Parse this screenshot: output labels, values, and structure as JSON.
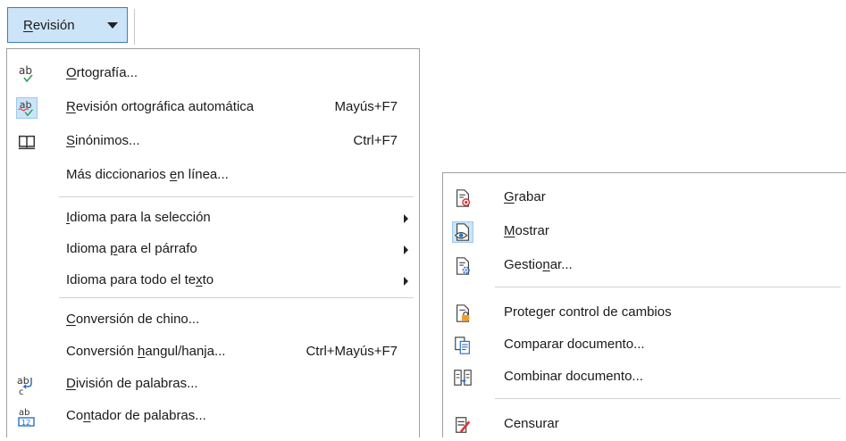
{
  "toolbar": {
    "button": {
      "label_u": "R",
      "label_rest": "evisión"
    }
  },
  "menu_review": {
    "items": [
      {
        "pre": "",
        "u": "O",
        "post": "rtografía...",
        "shortcut": "",
        "icon": "spellcheck-icon"
      },
      {
        "pre": "",
        "u": "R",
        "post": "evisión ortográfica automática",
        "shortcut": "Mayús+F7",
        "icon": "auto-spellcheck-icon"
      },
      {
        "pre": "",
        "u": "S",
        "post": "inónimos...",
        "shortcut": "Ctrl+F7",
        "icon": "thesaurus-book-icon"
      },
      {
        "pre": "Más diccionarios ",
        "u": "e",
        "post": "n línea...",
        "shortcut": ""
      },
      {
        "pre": "",
        "u": "I",
        "post": "dioma para la selección",
        "shortcut": ""
      },
      {
        "pre": "Idioma ",
        "u": "p",
        "post": "ara el párrafo",
        "shortcut": ""
      },
      {
        "pre": "Idioma para todo el te",
        "u": "x",
        "post": "to",
        "shortcut": ""
      },
      {
        "pre": "",
        "u": "C",
        "post": "onversión de chino...",
        "shortcut": ""
      },
      {
        "pre": "Conversión ",
        "u": "h",
        "post": "angul/hanja...",
        "shortcut": "Ctrl+Mayús+F7"
      },
      {
        "pre": "",
        "u": "D",
        "post": "ivisión de palabras...",
        "shortcut": "",
        "icon": "hyphenation-icon"
      },
      {
        "pre": "Co",
        "u": "n",
        "post": "tador de palabras...",
        "shortcut": "",
        "icon": "word-count-icon"
      }
    ]
  },
  "menu_track_changes": {
    "items": [
      {
        "pre": "",
        "u": "G",
        "post": "rabar",
        "icon": "record-changes-icon"
      },
      {
        "pre": "",
        "u": "M",
        "post": "ostrar",
        "icon": "show-changes-icon"
      },
      {
        "pre": "Gestio",
        "u": "n",
        "post": "ar...",
        "icon": "manage-changes-icon"
      },
      {
        "pre": "Proteger control de cambios",
        "u": "",
        "post": "",
        "icon": "protect-changes-icon"
      },
      {
        "pre": "Comparar documento...",
        "u": "",
        "post": "",
        "icon": "compare-document-icon"
      },
      {
        "pre": "Combinar documento...",
        "u": "",
        "post": "",
        "icon": "merge-document-icon"
      },
      {
        "pre": "Censurar",
        "u": "",
        "post": "",
        "icon": "redact-icon"
      }
    ]
  }
}
